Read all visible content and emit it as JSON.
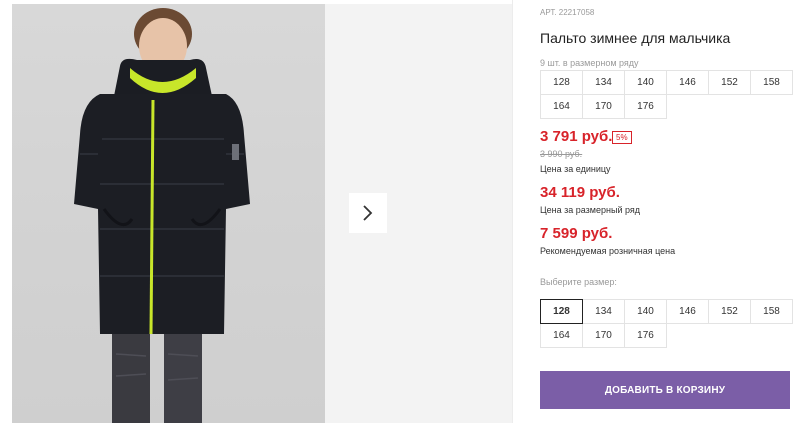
{
  "product": {
    "sku": "АРТ. 22217058",
    "title": "Пальто зимнее для мальчика",
    "pack_note": "9 шт. в размерном ряду"
  },
  "pack_sizes": [
    "128",
    "134",
    "140",
    "146",
    "152",
    "158",
    "164",
    "170",
    "176"
  ],
  "pricing": {
    "unit_price": "3 791 руб.",
    "discount": "5%",
    "old_price": "3 990 руб.",
    "unit_label": "Цена за единицу",
    "pack_price": "34 119 руб.",
    "pack_label": "Цена за размерный ряд",
    "rrp_price": "7 599 руб.",
    "rrp_label": "Рекомендуемая розничная цена"
  },
  "size_selector": {
    "label": "Выберите размер:",
    "selected": "128",
    "options": [
      "128",
      "134",
      "140",
      "146",
      "152",
      "158",
      "164",
      "170",
      "176"
    ]
  },
  "cart": {
    "button_label": "ДОБАВИТЬ В КОРЗИНУ"
  },
  "gallery": {
    "next_icon": "chevron-right-icon"
  },
  "colors": {
    "price_red": "#d8232a",
    "button_purple": "#7b5ea7",
    "coat": "#1c1e24",
    "zipper_accent": "#c8e62a"
  }
}
